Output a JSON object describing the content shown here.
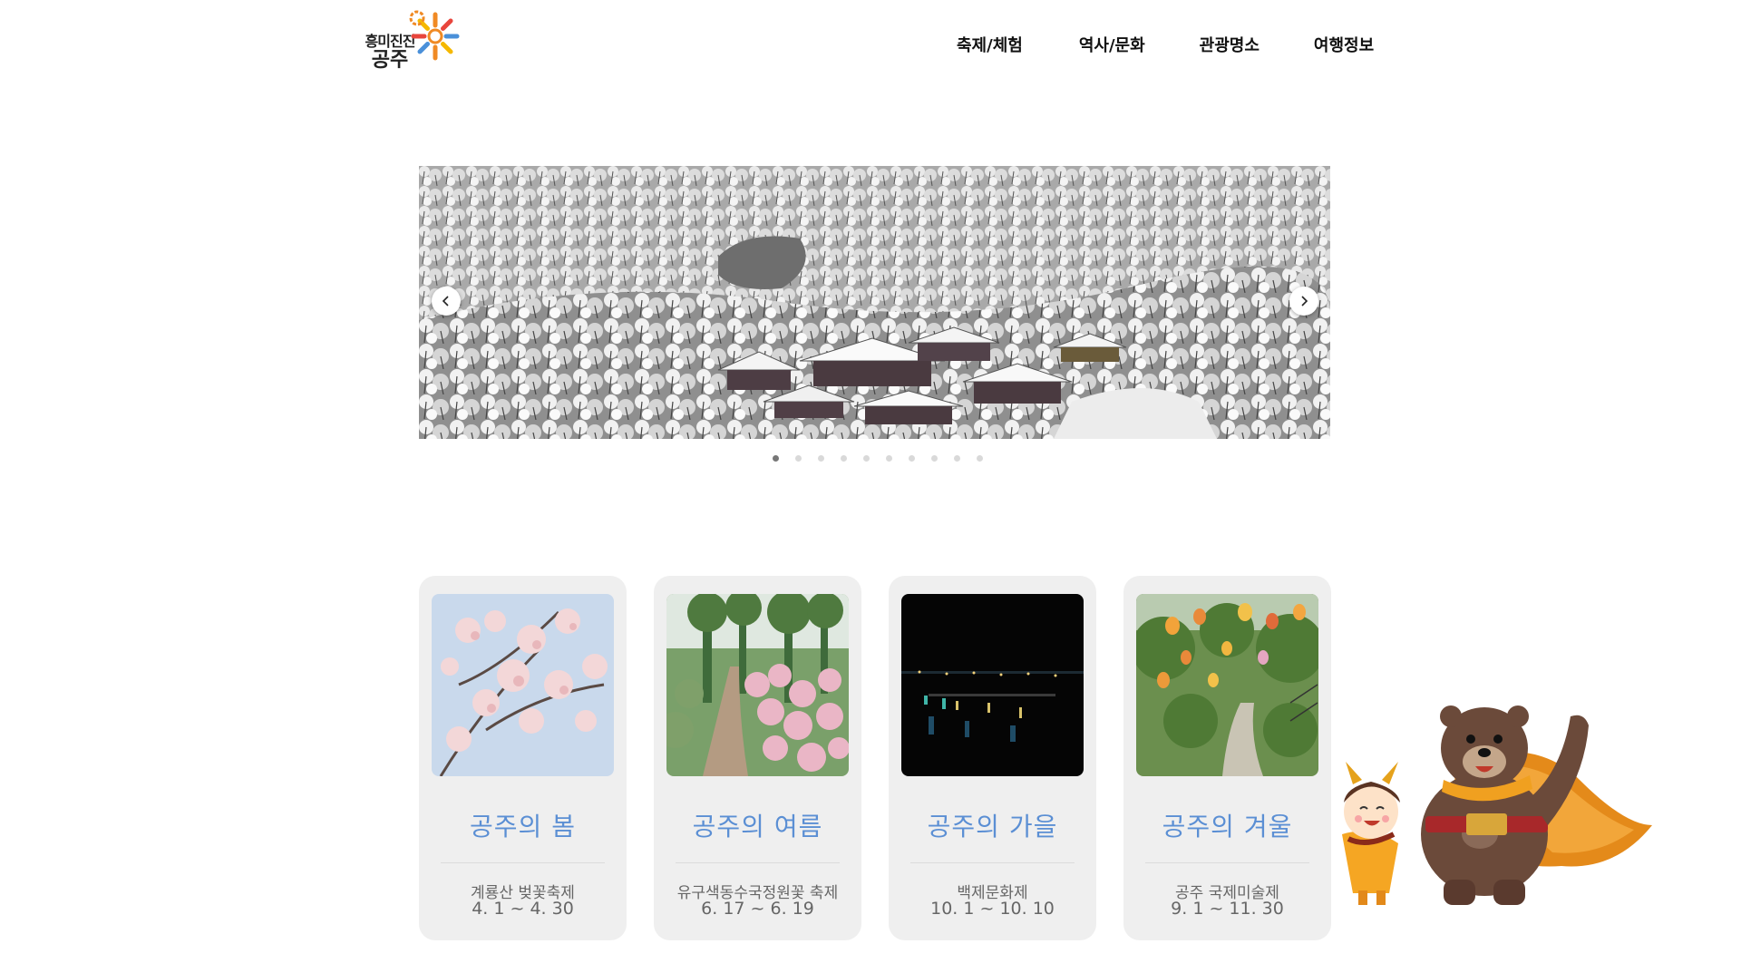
{
  "logo": {
    "line1": "흥미진진",
    "line2": "공주"
  },
  "nav": {
    "items": [
      {
        "label": "축제/체험"
      },
      {
        "label": "역사/문화"
      },
      {
        "label": "관광명소"
      },
      {
        "label": "여행정보"
      }
    ]
  },
  "slider": {
    "slide_count": 10,
    "active_index": 0,
    "prev_icon": "chevron-left-icon",
    "next_icon": "chevron-right-icon"
  },
  "seasons": [
    {
      "title": "공주의 봄",
      "event": "계룡산 벚꽃축제",
      "dates": "4. 1 ~ 4. 30"
    },
    {
      "title": "공주의 여름",
      "event": "유구색동수국정원꽃 축제",
      "dates": "6. 17 ~ 6. 19"
    },
    {
      "title": "공주의 가을",
      "event": "백제문화제",
      "dates": "10. 1 ~ 10. 10"
    },
    {
      "title": "공주의 겨울",
      "event": "공주 국제미술제",
      "dates": "9. 1 ~ 11. 30"
    }
  ],
  "colors": {
    "season_title": "#5b8fd4",
    "card_bg": "#efefef",
    "dot_active": "#777777",
    "dot_inactive": "#d9d9d9",
    "logo_orange": "#f08a24",
    "logo_blue": "#4a90d9"
  }
}
